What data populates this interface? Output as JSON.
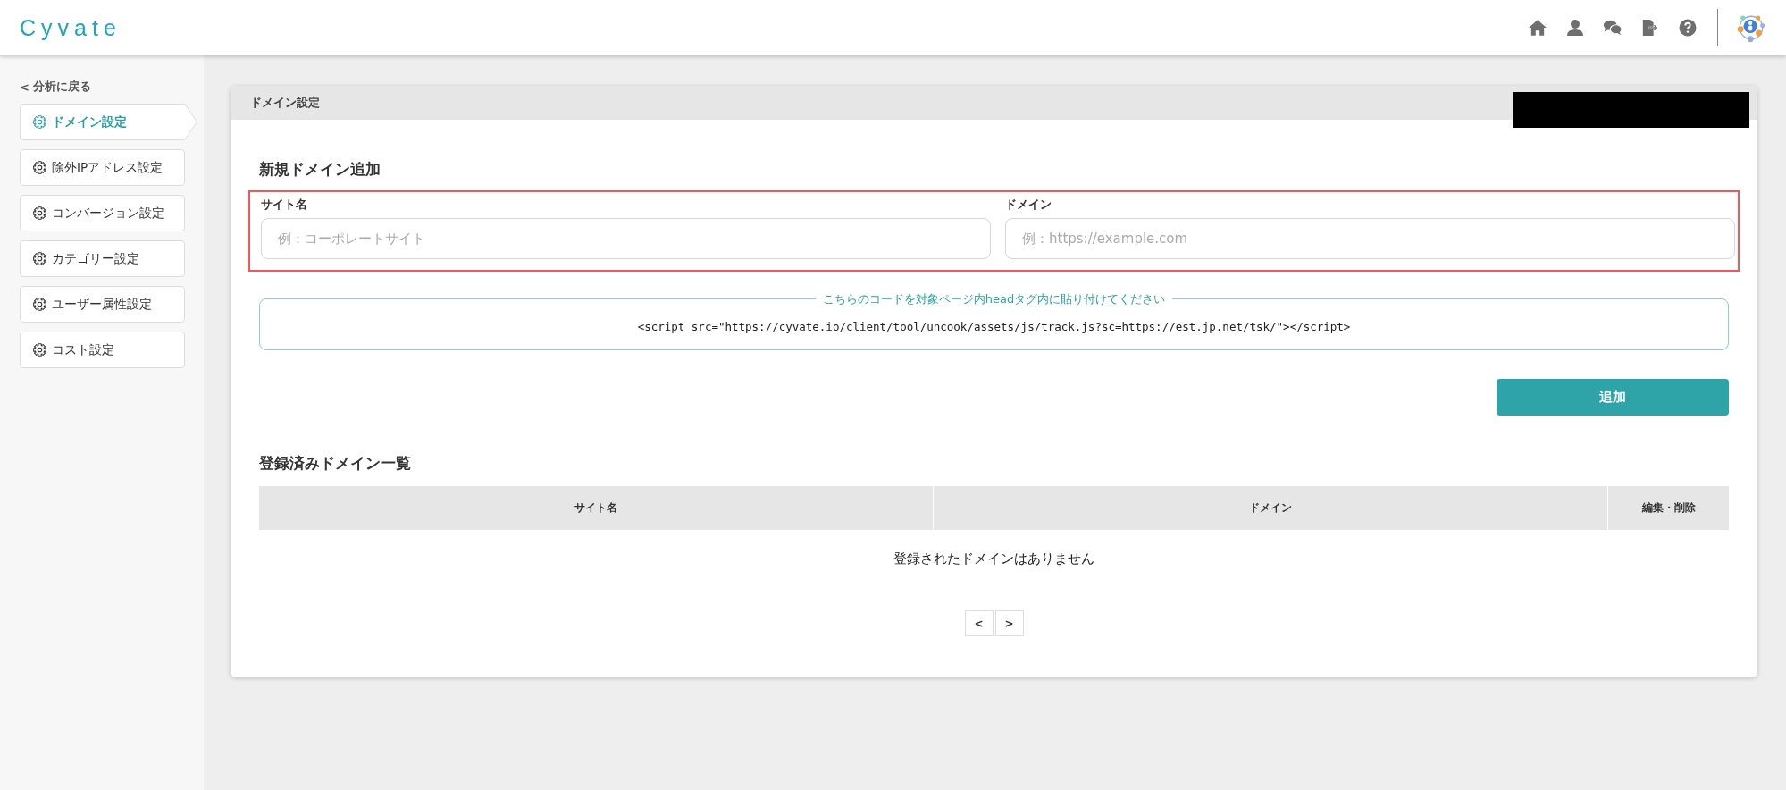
{
  "header": {
    "logo": "Cyvate"
  },
  "sidebar": {
    "back_link": {
      "arrow": "<",
      "label": "分析に戻る"
    },
    "items": [
      {
        "label": "ドメイン設定",
        "selected": true
      },
      {
        "label": "除外IPアドレス設定",
        "selected": false
      },
      {
        "label": "コンバージョン設定",
        "selected": false
      },
      {
        "label": "カテゴリー設定",
        "selected": false
      },
      {
        "label": "ユーザー属性設定",
        "selected": false
      },
      {
        "label": "コスト設定",
        "selected": false
      }
    ]
  },
  "card": {
    "title": "ドメイン設定",
    "redacted": true
  },
  "new_domain": {
    "title": "新規ドメイン追加",
    "highlighted": true,
    "fields": [
      {
        "label": "サイト名",
        "placeholder": "例：コーポレートサイト"
      },
      {
        "label": "ドメイン",
        "placeholder": "例：https://example.com"
      }
    ],
    "code_note": "こちらのコードを対象ページ内headタグ内に貼り付けてください",
    "code": "<script src=\"https://cyvate.io/client/tool/uncook/assets/js/track.js?sc=https://est.jp.net/tsk/\"></script>",
    "add_button": "追加"
  },
  "registered": {
    "title": "登録済みドメイン一覧",
    "table": {
      "columns": [
        "サイト名",
        "ドメイン",
        "編集・削除"
      ],
      "empty_message": "登録されたドメインはありません"
    },
    "pager": [
      "<",
      ">"
    ]
  }
}
